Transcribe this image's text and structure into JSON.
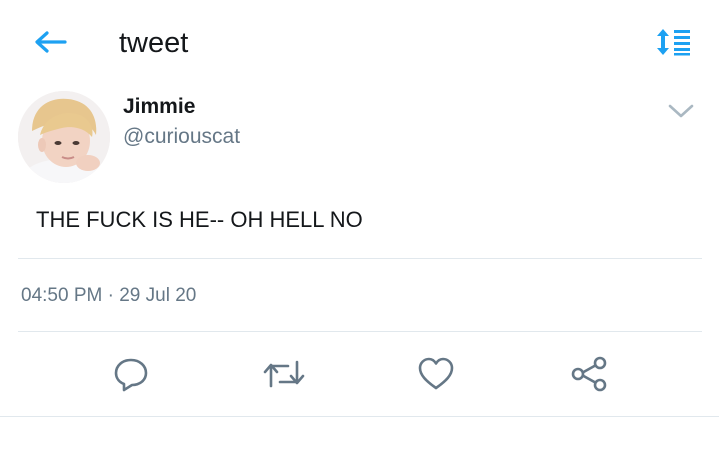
{
  "header": {
    "title": "tweet",
    "back_icon": "arrow-left-icon",
    "sort_icon": "sort-list-icon",
    "accent_color": "#1da1f2"
  },
  "tweet": {
    "author": {
      "display_name": "Jimmie",
      "handle": "@curiouscat"
    },
    "text": "THE FUCK IS HE-- OH HELL NO",
    "timestamp": "04:50 PM · 29 Jul 20",
    "menu_icon": "chevron-down-icon"
  },
  "actions": [
    {
      "icon": "reply-icon"
    },
    {
      "icon": "retweet-icon"
    },
    {
      "icon": "like-icon"
    },
    {
      "icon": "share-icon"
    }
  ],
  "colors": {
    "text_primary": "#14171a",
    "text_secondary": "#657786",
    "divider": "#e1e8ed",
    "icon_gray": "#657786"
  }
}
